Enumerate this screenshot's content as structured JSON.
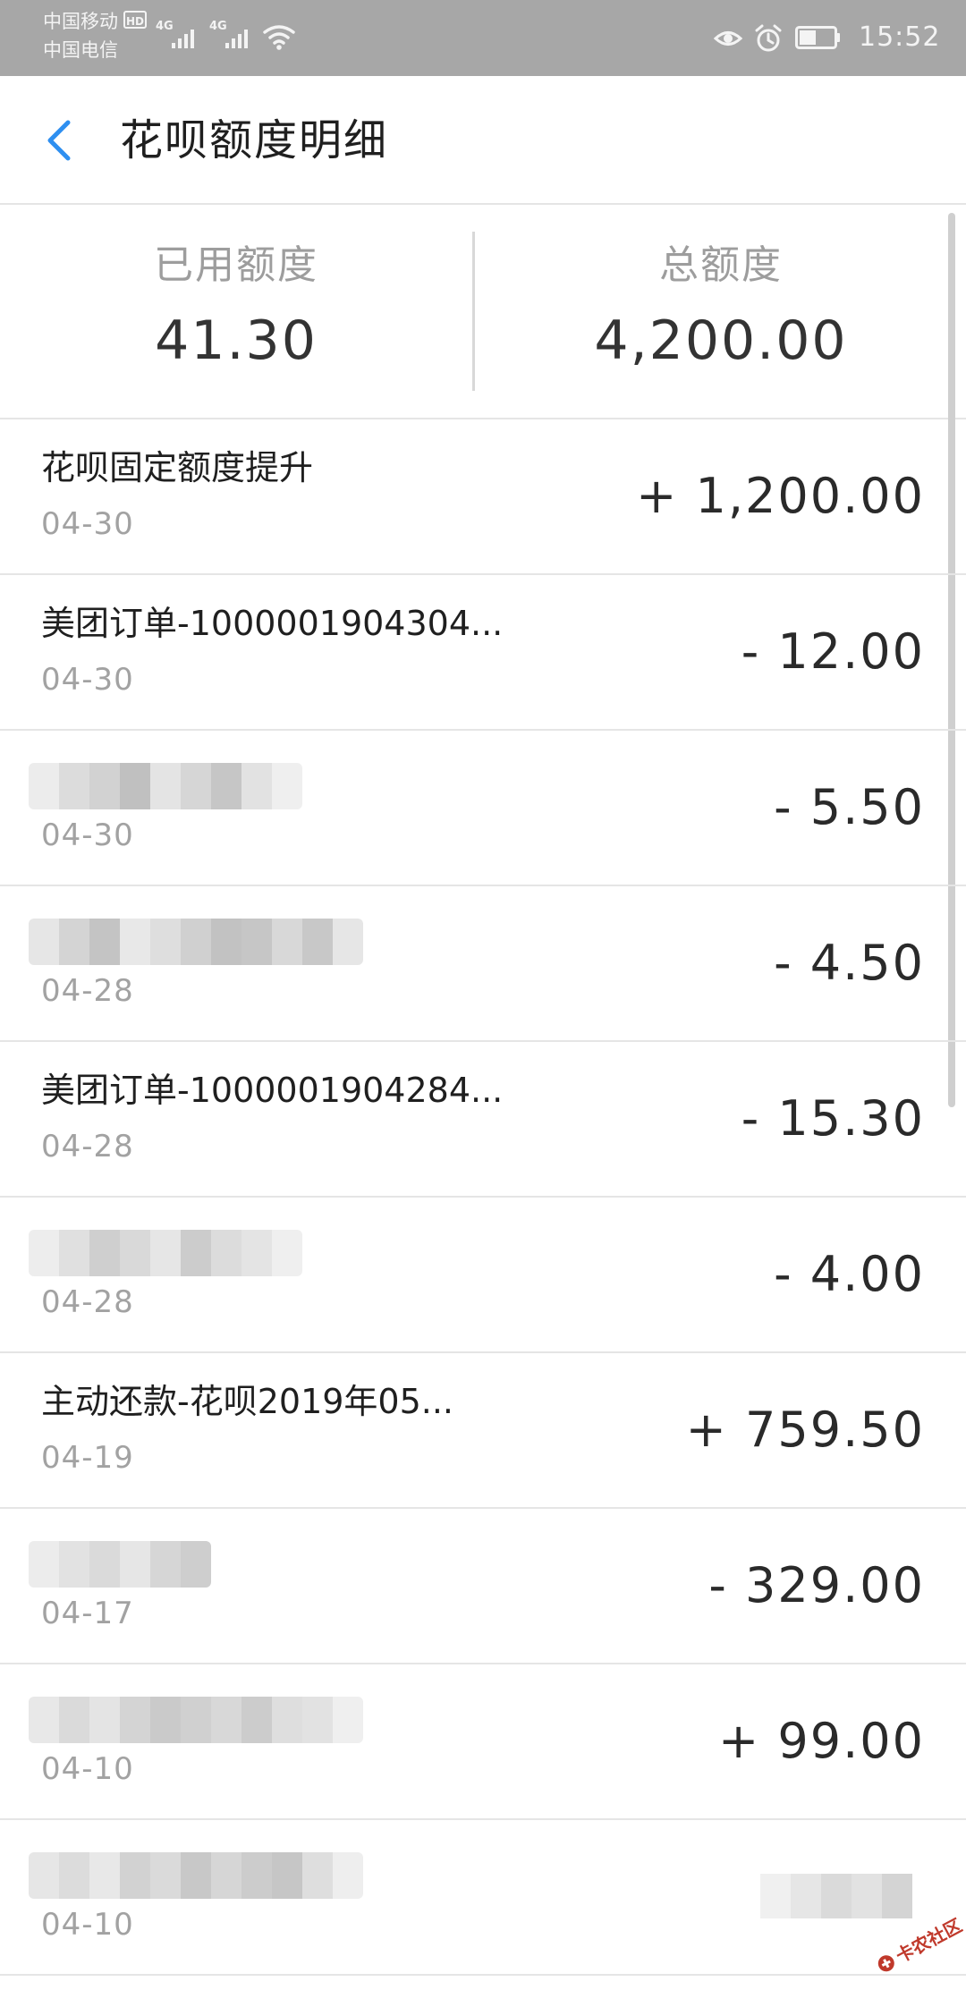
{
  "status_bar": {
    "carrier_1": "中国移动",
    "carrier_1_badge": "HD",
    "carrier_2": "中国电信",
    "network_1": "4G",
    "network_2": "4G",
    "time": "15:52",
    "icons": [
      "signal-icon",
      "signal-icon",
      "wifi-icon",
      "eye-icon",
      "alarm-icon",
      "battery-icon"
    ]
  },
  "header": {
    "back_icon": "chevron-left-icon",
    "title": "花呗额度明细",
    "accent_color": "#2e8ff0"
  },
  "summary": {
    "used_label": "已用额度",
    "used_value": "41.30",
    "total_label": "总额度",
    "total_value": "4,200.00"
  },
  "transactions": [
    {
      "title": "花呗固定额度提升",
      "date": "04-30",
      "amount": "+ 1,200.00",
      "title_blurred": false,
      "amount_blurred": false
    },
    {
      "title": "美团订单-1000001904304...",
      "date": "04-30",
      "amount": "- 12.00",
      "title_blurred": false,
      "amount_blurred": false
    },
    {
      "title": "",
      "date": "04-30",
      "amount": "- 5.50",
      "title_blurred": true,
      "amount_blurred": false
    },
    {
      "title": "",
      "date": "04-28",
      "amount": "- 4.50",
      "title_blurred": true,
      "amount_blurred": false
    },
    {
      "title": "美团订单-1000001904284...",
      "date": "04-28",
      "amount": "- 15.30",
      "title_blurred": false,
      "amount_blurred": false
    },
    {
      "title": "",
      "date": "04-28",
      "amount": "- 4.00",
      "title_blurred": true,
      "amount_blurred": false
    },
    {
      "title": "主动还款-花呗2019年05...",
      "date": "04-19",
      "amount": "+ 759.50",
      "title_blurred": false,
      "amount_blurred": false
    },
    {
      "title": "",
      "date": "04-17",
      "amount": "- 329.00",
      "title_blurred": true,
      "amount_blurred": false
    },
    {
      "title": "",
      "date": "04-10",
      "amount": "+ 99.00",
      "title_blurred": true,
      "amount_blurred": false
    },
    {
      "title": "",
      "date": "04-10",
      "amount": "",
      "title_blurred": true,
      "amount_blurred": true
    }
  ],
  "watermark": {
    "text": "卡农社区",
    "color": "#c0392b"
  }
}
